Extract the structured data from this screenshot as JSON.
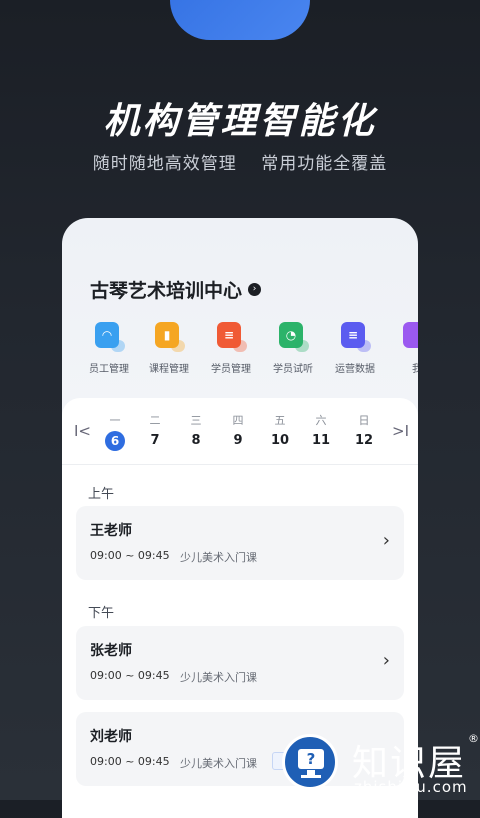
{
  "promo": {
    "headline": "机构管理智能化",
    "sub1": "随时随地高效管理",
    "sub2": "常用功能全覆盖"
  },
  "org": {
    "name": "古琴艺术培训中心",
    "arrow": "›"
  },
  "functions": [
    {
      "label": "员工管理",
      "icon": "staff-icon",
      "color": "#3aa0f0",
      "glyph": "◠"
    },
    {
      "label": "课程管理",
      "icon": "course-icon",
      "color": "#f5a623",
      "glyph": "▮"
    },
    {
      "label": "学员管理",
      "icon": "student-icon",
      "color": "#f05a35",
      "glyph": "≡"
    },
    {
      "label": "学员试听",
      "icon": "trial-icon",
      "color": "#2cb36a",
      "glyph": "◔"
    },
    {
      "label": "运营数据",
      "icon": "data-icon",
      "color": "#5b5cf0",
      "glyph": "≡"
    },
    {
      "label": "我",
      "icon": "more-icon",
      "color": "#9b59f0",
      "glyph": ""
    }
  ],
  "calendar": {
    "prev": "I<",
    "next": ">I",
    "days": [
      {
        "weekday": "一",
        "date": "6",
        "active": true
      },
      {
        "weekday": "二",
        "date": "7"
      },
      {
        "weekday": "三",
        "date": "8"
      },
      {
        "weekday": "四",
        "date": "9"
      },
      {
        "weekday": "五",
        "date": "10"
      },
      {
        "weekday": "六",
        "date": "11"
      },
      {
        "weekday": "日",
        "date": "12"
      }
    ]
  },
  "schedule": {
    "morning_label": "上午",
    "afternoon_label": "下午",
    "cards": [
      {
        "teacher": "王老师",
        "time": "09:00 ~ 09:45",
        "course": "少儿美术入门课"
      },
      {
        "teacher": "张老师",
        "time": "09:00 ~ 09:45",
        "course": "少儿美术入门课"
      },
      {
        "teacher": "刘老师",
        "time": "09:00 ~ 09:45",
        "course": "少儿美术入门课"
      }
    ],
    "chevron": "›"
  },
  "watermark": {
    "title": "知识屋",
    "domain": "zhishiwu.com",
    "reg": "®",
    "glyph": "?"
  }
}
